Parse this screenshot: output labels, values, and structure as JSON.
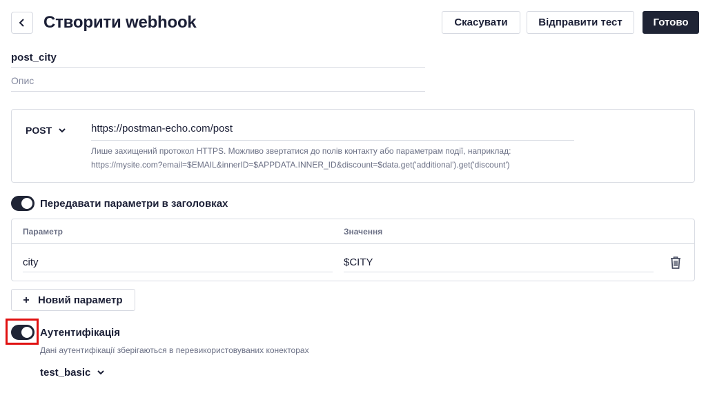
{
  "header": {
    "title": "Створити webhook",
    "cancel_label": "Скасувати",
    "test_label": "Відправити тест",
    "done_label": "Готово"
  },
  "webhook": {
    "name": "post_city",
    "description_placeholder": "Опис"
  },
  "request": {
    "method": "POST",
    "url": "https://postman-echo.com/post",
    "hint_line1": "Лише захищений протокол HTTPS. Можливо звертатися до полів контакту або параметрам події, наприклад:",
    "hint_line2": "https://mysite.com?email=$EMAIL&innerID=$APPDATA.INNER_ID&discount=$data.get('additional').get('discount')"
  },
  "headers_section": {
    "enabled": true,
    "label": "Передавати параметри в заголовках",
    "columns": [
      "Параметр",
      "Значення"
    ],
    "rows": [
      {
        "param": "city",
        "value": "$CITY"
      }
    ],
    "add_label": "Новий параметр"
  },
  "auth_section": {
    "enabled": true,
    "label": "Аутентифікація",
    "hint": "Дані аутентифікації зберігаються в перевикористовуваних конекторах",
    "connector": "test_basic"
  },
  "colors": {
    "primary_dark": "#1f2435",
    "highlight": "#e01010",
    "border": "#d9dce3"
  }
}
